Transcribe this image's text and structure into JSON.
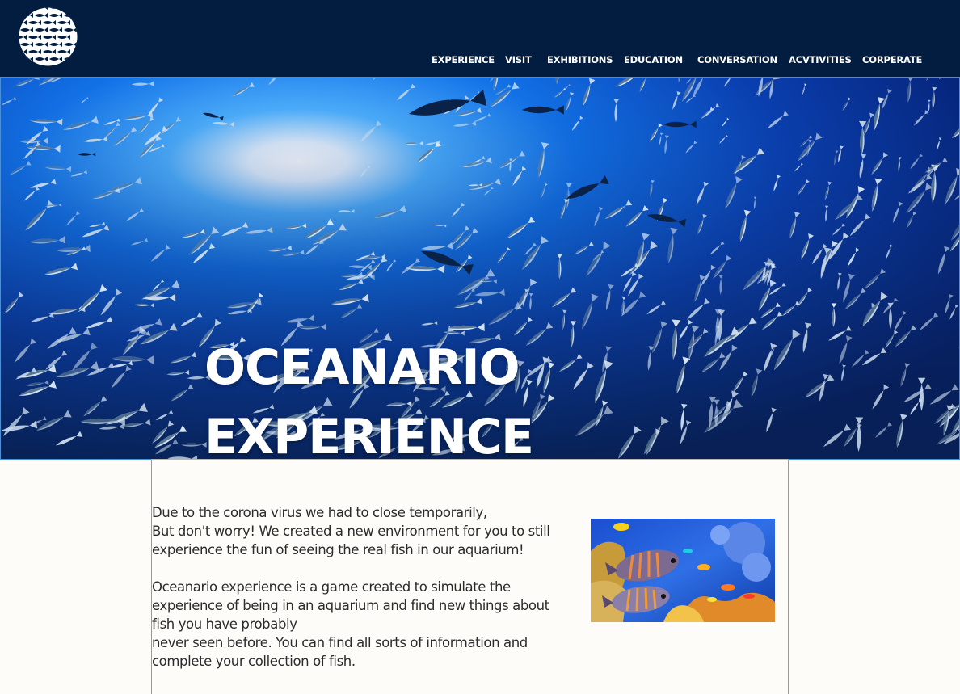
{
  "header": {
    "logo_icon": "fish-school-logo-icon",
    "background": "#021d40"
  },
  "nav": {
    "items": [
      {
        "label": "EXPERIENCE"
      },
      {
        "label": "VISIT"
      },
      {
        "label": "EXHIBITIONS"
      },
      {
        "label": "EDUCATION"
      },
      {
        "label": "CONVERSATION"
      },
      {
        "label": "ACVTIVITIES"
      },
      {
        "label": "CORPERATE"
      }
    ]
  },
  "hero": {
    "title_line1": "OCEANARIO",
    "title_line2": "EXPERIENCE",
    "image": "underwater-fish-school-photo"
  },
  "content": {
    "paragraph1_lines": [
      "Due to the corona virus we had to close temporarily,",
      "But don't worry! We created a new environment for you to still",
      "experience the fun of seeing the real fish in our aquarium!"
    ],
    "paragraph2_lines": [
      "Oceanario experience is a game created to simulate the",
      "experience of being in an aquarium and find new things about",
      "fish you have probably",
      "never seen before.  You can find all sorts of information and",
      "complete your collection of fish."
    ],
    "thumbnail": "coral-reef-fish-photo"
  }
}
